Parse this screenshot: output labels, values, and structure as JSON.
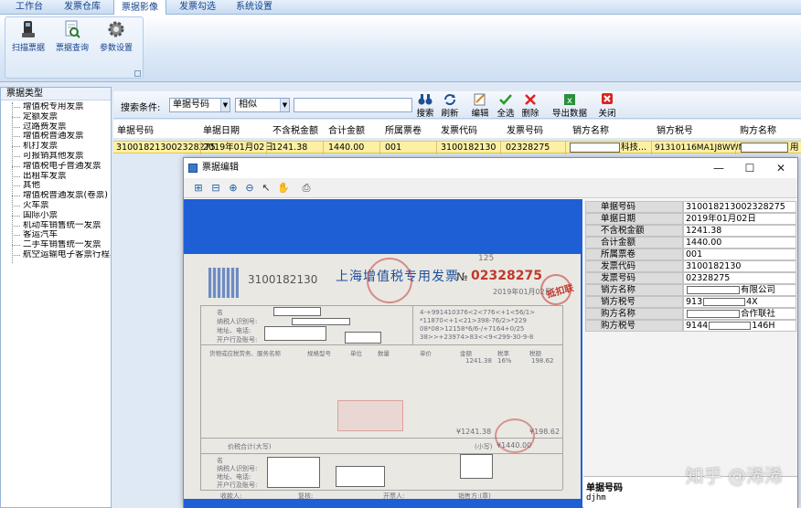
{
  "tabs": [
    "工作台",
    "发票仓库",
    "票据影像",
    "发票勾选",
    "系统设置"
  ],
  "ribbon": {
    "buttons": [
      {
        "label": "扫描票据",
        "icon": "scanner-icon"
      },
      {
        "label": "票据查询",
        "icon": "document-search-icon"
      },
      {
        "label": "参数设置",
        "icon": "gear-icon"
      }
    ]
  },
  "left_panel": {
    "title": "票据类型",
    "items": [
      "增值税专用发票",
      "定额发票",
      "过路费发票",
      "增值税普通发票",
      "机打发票",
      "可报销其他发票",
      "增值税电子普通发票",
      "出租车发票",
      "其他",
      "增值税普通发票(卷票)",
      "火车票",
      "国际小票",
      "机动车销售统一发票",
      "客运汽车",
      "二手车销售统一发票",
      "航空运输电子客票行程单"
    ]
  },
  "toolbar": {
    "search_label": "搜索条件:",
    "field_select": "单据号码",
    "match_select": "相似",
    "search_value": "",
    "buttons": [
      {
        "label": "搜索",
        "icon": "binoculars-icon"
      },
      {
        "label": "刷新",
        "icon": "refresh-icon"
      },
      {
        "label": "编辑",
        "icon": "edit-icon"
      },
      {
        "label": "全选",
        "icon": "checkmark-icon"
      },
      {
        "label": "删除",
        "icon": "delete-x-icon"
      },
      {
        "label": "导出数据",
        "icon": "excel-export-icon"
      },
      {
        "label": "关闭",
        "icon": "close-icon"
      }
    ]
  },
  "grid": {
    "columns": [
      "单据号码",
      "单据日期",
      "不含税金额",
      "合计金额",
      "所属票卷",
      "发票代码",
      "发票号码",
      "销方名称",
      "销方税号",
      "购方名称"
    ],
    "row": {
      "doc_no": "310018213002328275",
      "date": "2019年01月02日",
      "amount": "1241.38",
      "total": "1440.00",
      "volume": "001",
      "inv_code": "3100182130",
      "inv_no": "02328275",
      "seller_tail": "科技...",
      "seller_tax": "91310116MA1J8WWN4X",
      "buyer_tail": "用"
    }
  },
  "dialog": {
    "title": "票据编辑",
    "controls": [
      "—",
      "☐",
      "✕"
    ],
    "tool_icons": [
      "fit-page-icon",
      "fit-width-icon",
      "zoom-in-icon",
      "zoom-out-icon",
      "pointer-icon",
      "pan-hand-icon",
      "print-icon"
    ],
    "details": [
      {
        "k": "单据号码",
        "v": "310018213002328275"
      },
      {
        "k": "单据日期",
        "v": "2019年01月02日"
      },
      {
        "k": "不含税金额",
        "v": "1241.38"
      },
      {
        "k": "合计金额",
        "v": "1440.00"
      },
      {
        "k": "所属票卷",
        "v": "001"
      },
      {
        "k": "发票代码",
        "v": "3100182130"
      },
      {
        "k": "发票号码",
        "v": "02328275"
      },
      {
        "k": "销方名称",
        "v": "有限公司"
      },
      {
        "k": "销方税号",
        "v": "913",
        "v2": "4X"
      },
      {
        "k": "购方名称",
        "v": "合作联社"
      },
      {
        "k": "购方税号",
        "v": "9144",
        "v2": "146H"
      }
    ],
    "desc_title": "单据号码",
    "desc_value": "djhm"
  },
  "invoice": {
    "code": "3100182130",
    "title": "上海增值税专用发票",
    "no_prefix": "№",
    "number": "02328275",
    "date": "2019年01月02日",
    "page_mark": "125",
    "stamp_text": "抵扣联",
    "buyer_labels": [
      "名",
      "纳税人识别号:",
      "地址、电话:",
      "开户行及账号:"
    ],
    "seller_labels": [
      "名",
      "纳税人识别号:",
      "地址、电话:",
      "开户行及账号:"
    ],
    "cipher": [
      "4-+991410376<2<776<+1<56/1>",
      "*11870<+1<21>398-76/2>*229",
      "08*08>12158*6/6-/+7164+0/25",
      "38>>+23974>83<<9<299-30-9-8"
    ],
    "header_cols": [
      "货物或应税劳务、服务名称",
      "规格型号",
      "单位",
      "数量",
      "单价",
      "金额",
      "税率",
      "税额"
    ],
    "amount": "1241.38",
    "tax_rate": "16%",
    "tax": "198.62",
    "sum_amount": "¥1241.38",
    "sum_tax": "¥198.62",
    "total_label": "价税合计(大写)",
    "small_label": "(小写)",
    "small_total": "¥1440.00",
    "footer": [
      "收款人:",
      "复核:",
      "开票人:",
      "销售方:(章)"
    ]
  },
  "watermark": "知乎 @浠浠"
}
